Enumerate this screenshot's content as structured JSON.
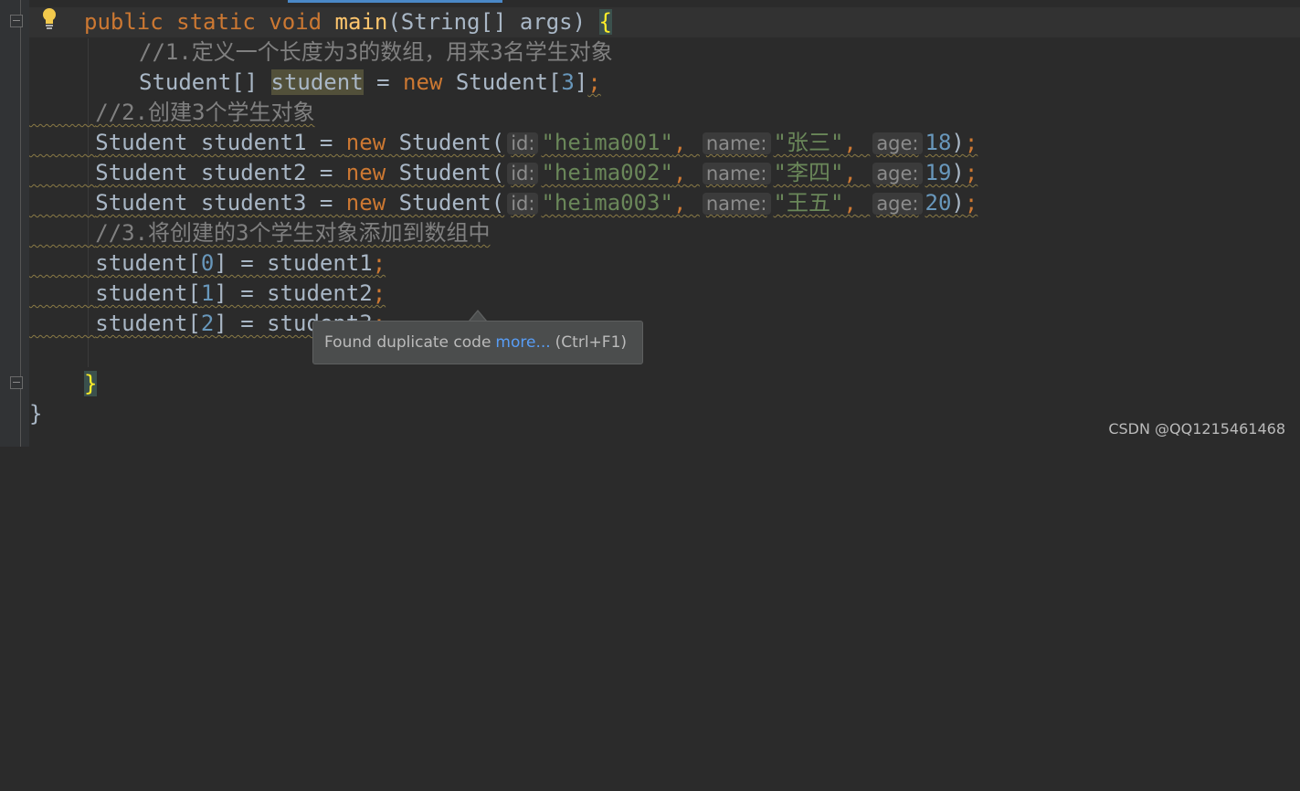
{
  "editor": {
    "lines": {
      "l1": {
        "kw": "public static void",
        "fn": "main",
        "params": "(String[] args)",
        "brace": "{"
      },
      "l2": {
        "comment": "//1.定义一个长度为3的数组，用来3名学生对象"
      },
      "l3": {
        "a": "Student[] ",
        "var": "student",
        "b": " = ",
        "kw": "new",
        "c": " Student[",
        "num": "3",
        "d": "]",
        "semi": ";"
      },
      "l4": {
        "comment": "//2.创建3个学生对象"
      },
      "l5": {
        "a": "Student student1 = ",
        "kw": "new",
        "b": " Student(",
        "hint_id": "id:",
        "s_id": "\"heima001\"",
        "comma1": ",",
        "hint_name": "name:",
        "s_name": "\"张三\"",
        "comma2": ",",
        "hint_age": "age:",
        "num": "18",
        "end": ")",
        "semi": ";"
      },
      "l6": {
        "a": "Student student2 = ",
        "kw": "new",
        "b": " Student(",
        "hint_id": "id:",
        "s_id": "\"heima002\"",
        "comma1": ",",
        "hint_name": "name:",
        "s_name": "\"李四\"",
        "comma2": ",",
        "hint_age": "age:",
        "num": "19",
        "end": ")",
        "semi": ";"
      },
      "l7": {
        "a": "Student student3 = ",
        "kw": "new",
        "b": " Student(",
        "hint_id": "id:",
        "s_id": "\"heima003\"",
        "comma1": ",",
        "hint_name": "name:",
        "s_name": "\"王五\"",
        "comma2": ",",
        "hint_age": "age:",
        "num": "20",
        "end": ")",
        "semi": ";"
      },
      "l8": {
        "comment": "//3.将创建的3个学生对象添加到数组中"
      },
      "l9": {
        "a": "student[",
        "num": "0",
        "b": "] = student1",
        "semi": ";"
      },
      "l10": {
        "a": "student[",
        "num": "1",
        "b": "] = student2",
        "semi": ";"
      },
      "l11": {
        "a": "student[",
        "num": "2",
        "b": "] = student3",
        "semi": ";"
      },
      "l13": {
        "brace": "}"
      },
      "l14": {
        "brace": "}"
      }
    }
  },
  "tooltip": {
    "text": "Found duplicate code",
    "link": "more...",
    "shortcut": "(Ctrl+F1)"
  },
  "watermark": "CSDN @QQ1215461468",
  "icons": {
    "bulb": "lightbulb-icon",
    "fold": "fold-marker-icon"
  },
  "colors": {
    "background": "#2b2b2b",
    "keyword": "#cc7832",
    "string": "#6a8759",
    "number": "#6897bb",
    "comment": "#808080",
    "method": "#ffc66d"
  }
}
